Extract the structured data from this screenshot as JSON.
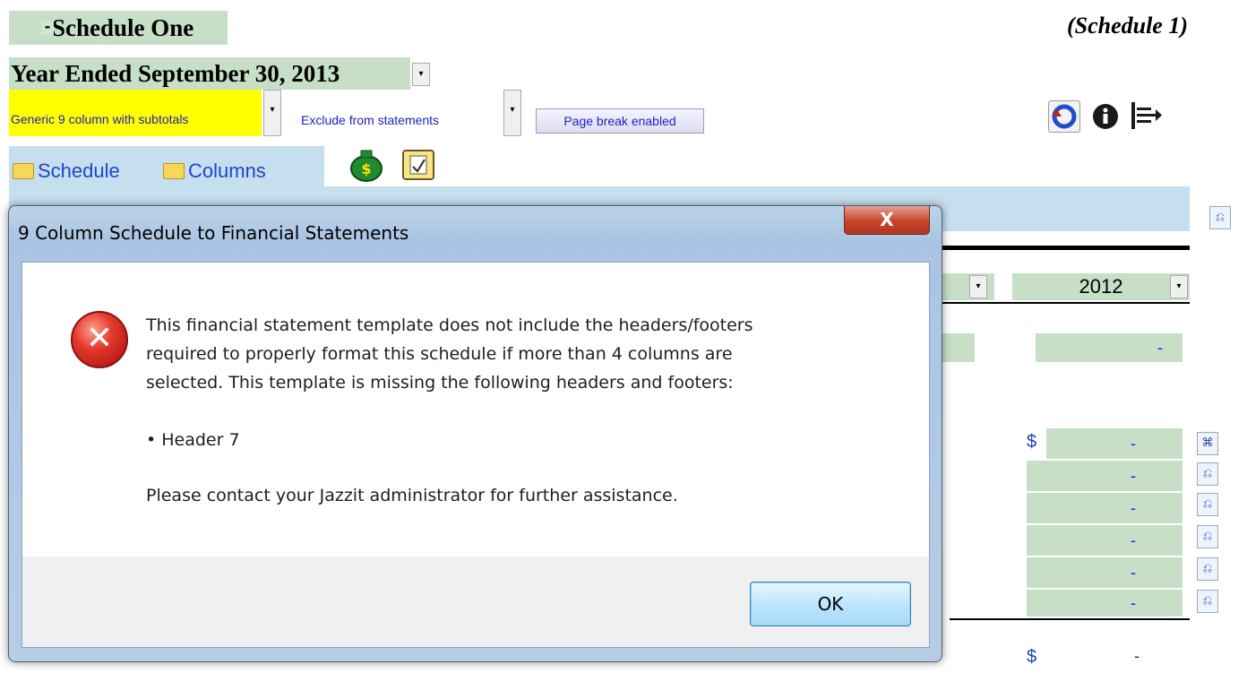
{
  "worksheet": {
    "schedule_title": "Schedule One",
    "collapse_glyph": "-",
    "schedule_ref": "(Schedule 1)",
    "year_ended": "Year Ended September 30, 2013",
    "template_option": "Generic 9 column with subtotals",
    "exclude_option": "Exclude from statements",
    "page_break_label": "Page break enabled",
    "tab_schedule": "Schedule",
    "tab_columns": "Columns",
    "column_year": "2012",
    "dash": "-",
    "dollar": "$",
    "toolbar_icons": [
      "undo-icon",
      "info-icon",
      "export-icon"
    ],
    "tab_icons": [
      "money-bag-icon",
      "clipboard-icon"
    ]
  },
  "dialog": {
    "title": "9 Column Schedule to Financial Statements",
    "close_label": "X",
    "icon": "error-icon",
    "message_lines": [
      "This financial statement template does not include the headers/footers",
      "required to properly format this schedule if more than 4 columns are",
      "selected. This template is missing the following headers and footers:"
    ],
    "missing_item": "• Header 7",
    "contact_line": "Please contact your Jazzit administrator for further assistance.",
    "ok_label": "OK"
  },
  "colors": {
    "green_fill": "#c6dfc6",
    "blue_fill": "#c6dfef",
    "highlight": "#ffff00",
    "link_blue": "#2020c0"
  }
}
